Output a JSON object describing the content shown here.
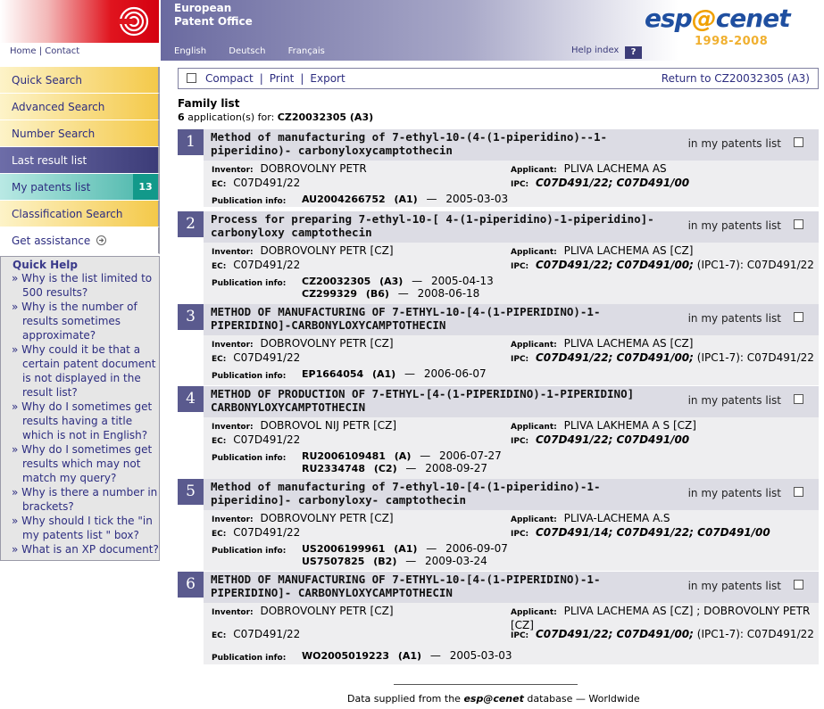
{
  "header": {
    "org_line1": "European",
    "org_line2": "Patent Office",
    "home": "Home",
    "contact": "Contact",
    "languages": [
      "English",
      "Deutsch",
      "Français"
    ],
    "help_index": "Help index",
    "help_q": "?",
    "brand_part1": "esp",
    "brand_at": "@",
    "brand_part2": "cenet",
    "brand_years": "1998-2008"
  },
  "sidebar": {
    "items": [
      {
        "label": "Quick Search"
      },
      {
        "label": "Advanced Search"
      },
      {
        "label": "Number Search"
      },
      {
        "label": "Last result list"
      },
      {
        "label": "My patents list",
        "badge": "13"
      },
      {
        "label": "Classification Search"
      },
      {
        "label": "Get assistance"
      }
    ],
    "quick_help_title": "Quick Help",
    "quick_help": [
      "Why is the list limited to 500 results?",
      "Why is the number of results sometimes approximate?",
      "Why could it be that a certain patent document is not displayed in the result list?",
      "Why do I sometimes get results having a title which is not in English?",
      "Why do I sometimes get results which may not match my query?",
      "Why is there a number in brackets?",
      "Why should I tick the \"in my patents list \" box?",
      "What is an XP document?"
    ]
  },
  "toolbar": {
    "compact": "Compact",
    "print": "Print",
    "export": "Export",
    "return": "Return to CZ20032305 (A3)"
  },
  "family": {
    "title": "Family list",
    "count": "6",
    "count_text": "application(s) for:",
    "doc": "CZ20032305 (A3)"
  },
  "labels": {
    "inventor": "Inventor:",
    "applicant": "Applicant:",
    "ec": "EC:",
    "ipc": "IPC:",
    "pubinfo": "Publication info:",
    "in_my_list": "in my patents list"
  },
  "entries": [
    {
      "num": "1",
      "title": "Method of manufacturing of 7-ethyl-10-(4-(1-piperidino)--1-piperidino)- carbonyloxycamptothecin",
      "inventor": "DOBROVOLNY PETR",
      "applicant": "PLIVA LACHEMA AS",
      "ec": "C07D491/22",
      "ipc_bold": "C07D491/22; C07D491/00",
      "ipc_extra": "",
      "pubs": [
        {
          "no": "AU2004266752",
          "kind": "(A1)",
          "date": "2005-03-03"
        }
      ]
    },
    {
      "num": "2",
      "title": "Process for preparing 7-ethyl-10-[ 4-(1-piperidino)-1-piperidino]- carbonyloxy camptothecin",
      "inventor": "DOBROVOLNY PETR [CZ]",
      "applicant": "PLIVA LACHEMA AS [CZ]",
      "ec": "C07D491/22",
      "ipc_bold": "C07D491/22; C07D491/00;",
      "ipc_extra": "(IPC1-7): C07D491/22",
      "pubs": [
        {
          "no": "CZ20032305",
          "kind": "(A3)",
          "date": "2005-04-13"
        },
        {
          "no": "CZ299329",
          "kind": "(B6)",
          "date": "2008-06-18"
        }
      ]
    },
    {
      "num": "3",
      "title": "METHOD OF MANUFACTURING OF 7-ETHYL-10-[4-(1-PIPERIDINO)-1-PIPERIDINO]-CARBONYLOXYCAMPTOTHECIN",
      "inventor": "DOBROVOLNY PETR [CZ]",
      "applicant": "PLIVA LACHEMA AS [CZ]",
      "ec": "C07D491/22",
      "ipc_bold": "C07D491/22; C07D491/00;",
      "ipc_extra": "(IPC1-7): C07D491/22",
      "pubs": [
        {
          "no": "EP1664054",
          "kind": "(A1)",
          "date": "2006-06-07"
        }
      ]
    },
    {
      "num": "4",
      "title": "METHOD OF PRODUCTION OF 7-ETHYL-[4-(1-PIPERIDINO)-1-PIPERIDINO] CARBONYLOXYCAMPTOTHECIN",
      "inventor": "DOBROVOL NIJ PETR [CZ]",
      "applicant": "PLIVA LAKHEMA A S [CZ]",
      "ec": "C07D491/22",
      "ipc_bold": "C07D491/22; C07D491/00",
      "ipc_extra": "",
      "pubs": [
        {
          "no": "RU2006109481",
          "kind": "(A)",
          "date": "2006-07-27"
        },
        {
          "no": "RU2334748",
          "kind": "(C2)",
          "date": "2008-09-27"
        }
      ]
    },
    {
      "num": "5",
      "title": "Method of manufacturing of 7-ethyl-10-[4-(1-piperidino)-1-piperidino]- carbonyloxy- camptothecin",
      "inventor": "DOBROVOLNY PETR [CZ]",
      "applicant": "PLIVA-LACHEMA A.S",
      "ec": "C07D491/22",
      "ipc_bold": "C07D491/14; C07D491/22; C07D491/00",
      "ipc_extra": "",
      "pubs": [
        {
          "no": "US2006199961",
          "kind": "(A1)",
          "date": "2006-09-07"
        },
        {
          "no": "US7507825",
          "kind": "(B2)",
          "date": "2009-03-24"
        }
      ]
    },
    {
      "num": "6",
      "title": "METHOD OF MANUFACTURING OF 7-ETHYL-10-[4-(1-PIPERIDINO)-1-PIPERIDINO]- CARBONYLOXYCAMPTOTHECIN",
      "inventor": "DOBROVOLNY PETR [CZ]",
      "applicant": "PLIVA LACHEMA AS [CZ] ; DOBROVOLNY PETR [CZ]",
      "ec": "C07D491/22",
      "ipc_bold": "C07D491/22; C07D491/00;",
      "ipc_extra": "(IPC1-7): C07D491/22",
      "pubs": [
        {
          "no": "WO2005019223",
          "kind": "(A1)",
          "date": "2005-03-03"
        }
      ]
    }
  ],
  "footer": {
    "prefix": "Data supplied from the",
    "brand": "esp@cenet",
    "suffix": "database — Worldwide"
  },
  "colors": {
    "nav_gold": "#f4c94a",
    "nav_active": "#3c3c78",
    "nav_teal": "#12998a",
    "number_box": "#5a5a8e",
    "title_bar": "#dcdce4",
    "details_bg": "#eeeef0",
    "epo_red": "#d40010"
  }
}
